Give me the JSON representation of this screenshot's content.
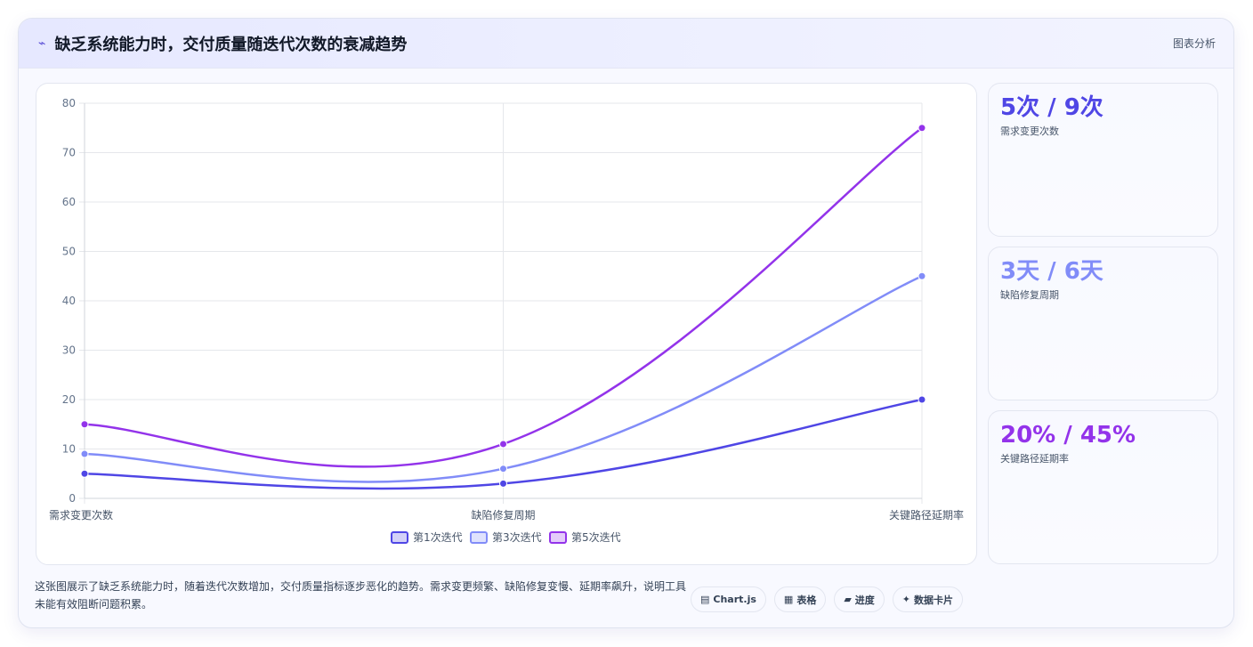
{
  "header": {
    "icon": "chart-line-icon",
    "icon_glyph": "⌁",
    "title": "缺乏系统能力时，交付质量随迭代次数的衰减趋势",
    "tag": "图表分析"
  },
  "chart_data": {
    "type": "line",
    "categories": [
      "需求变更次数",
      "缺陷修复周期",
      "关键路径延期率"
    ],
    "series": [
      {
        "name": "第1次迭代",
        "values": [
          5,
          3,
          20
        ],
        "color": "#4f46e5"
      },
      {
        "name": "第3次迭代",
        "values": [
          9,
          6,
          45
        ],
        "color": "#818cf8"
      },
      {
        "name": "第5次迭代",
        "values": [
          15,
          11,
          75
        ],
        "color": "#9333ea"
      }
    ],
    "y_ticks": [
      0,
      10,
      20,
      30,
      40,
      50,
      60,
      70,
      80
    ],
    "ylim": [
      0,
      80
    ],
    "grid": true,
    "legend_position": "bottom-center"
  },
  "stats": [
    {
      "value": "5次 / 9次",
      "label": "需求变更次数",
      "color": "#4f46e5"
    },
    {
      "value": "3天 / 6天",
      "label": "缺陷修复周期",
      "color": "#818cf8"
    },
    {
      "value": "20% / 45%",
      "label": "关键路径延期率",
      "color": "#9333ea"
    }
  ],
  "footer": {
    "description": "这张图展示了缺乏系统能力时，随着迭代次数增加，交付质量指标逐步恶化的趋势。需求变更频繁、缺陷修复变慢、延期率飙升，说明工具未能有效阻断问题积累。",
    "chips": [
      {
        "icon": "chart-icon",
        "glyph": "▤",
        "label": "Chart.js"
      },
      {
        "icon": "table-icon",
        "glyph": "▦",
        "label": "表格"
      },
      {
        "icon": "progress-icon",
        "glyph": "▰",
        "label": "进度"
      },
      {
        "icon": "sparkle-icon",
        "glyph": "✦",
        "label": "数据卡片"
      }
    ]
  }
}
